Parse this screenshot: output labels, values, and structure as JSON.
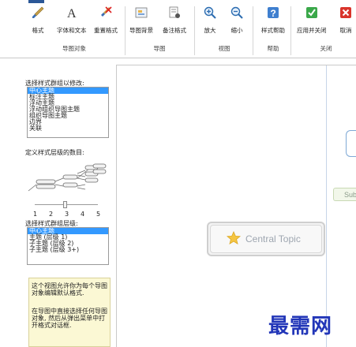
{
  "ribbon": {
    "groups": [
      {
        "label": "导图对象",
        "buttons": [
          {
            "label": "格式",
            "icon": "format-brush-icon"
          },
          {
            "label": "字体和文本",
            "icon": "font-text-icon"
          },
          {
            "label": "重置格式",
            "icon": "reset-format-icon"
          }
        ]
      },
      {
        "label": "导图",
        "buttons": [
          {
            "label": "导图背景",
            "icon": "map-background-icon"
          },
          {
            "label": "备注格式",
            "icon": "notes-format-icon"
          }
        ]
      },
      {
        "label": "视图",
        "buttons": [
          {
            "label": "放大",
            "icon": "zoom-in-icon"
          },
          {
            "label": "缩小",
            "icon": "zoom-out-icon"
          }
        ]
      },
      {
        "label": "帮助",
        "buttons": [
          {
            "label": "样式帮助",
            "icon": "style-help-icon"
          }
        ]
      },
      {
        "label": "关闭",
        "buttons": [
          {
            "label": "应用并关闭",
            "icon": "apply-close-icon"
          },
          {
            "label": "取消",
            "icon": "cancel-icon"
          }
        ]
      }
    ]
  },
  "left_panel": {
    "style_group_title": "选择样式群组以修改:",
    "style_groups": [
      "中心主题",
      "标注主题",
      "浮动主题",
      "浮动组织导图主题",
      "组织导图主题",
      "边界",
      "关联"
    ],
    "levels_title": "定义样式层级的数目:",
    "level_ticks": [
      "1",
      "2",
      "3",
      "4",
      "5"
    ],
    "level_value": 3,
    "level_group_title": "选择样式群组层级:",
    "level_groups": [
      "中心主题",
      "主题 (层级 1)",
      "子主题 (层级 2)",
      "子主题 (层级 3+)"
    ],
    "info_paragraphs": [
      "这个视图允许你为每个导图对象编辑默认格式.",
      "在导图中直接选择任何导图对象, 然后从弹出菜单中打开格式对话框."
    ]
  },
  "canvas": {
    "central_topic": "Central Topic",
    "sub_topic": "Sub",
    "colors": {
      "topic_border": "#7fa9d6",
      "sub_fill": "#f2f7ea",
      "central_fill": "#f3f3f3",
      "star": "#f5c542"
    }
  },
  "watermark": "最需网",
  "colors": {
    "selection": "#3399ff",
    "info_background": "#fbf8d4"
  }
}
